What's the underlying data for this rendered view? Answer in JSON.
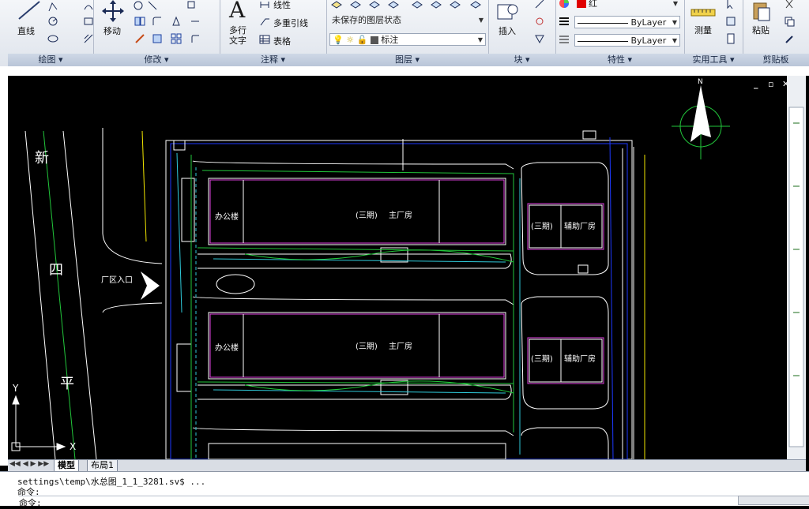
{
  "ribbon": {
    "panels": {
      "draw": {
        "title": "绘图",
        "line_label": "直线"
      },
      "modify": {
        "title": "修改",
        "move_label": "移动"
      },
      "annotation": {
        "title": "注释",
        "mtext_label_1": "多行",
        "mtext_label_2": "文字",
        "linear_label": "线性",
        "mleader_label": "多重引线",
        "table_label": "表格"
      },
      "layers": {
        "title": "图层",
        "layer_state": "未保存的图层状态",
        "current_layer": "标注"
      },
      "block": {
        "title": "块",
        "insert_label": "插入"
      },
      "properties": {
        "title": "特性",
        "color": "红",
        "linetype": "ByLayer",
        "lineweight": "ByLayer"
      },
      "utilities": {
        "title": "实用工具",
        "measure_label": "测量"
      },
      "clipboard": {
        "title": "剪贴板",
        "paste_label": "粘贴"
      }
    }
  },
  "drawing": {
    "road_labels": [
      "新",
      "四",
      "平"
    ],
    "entrance_label": "厂区入口",
    "building_labels": {
      "office1": "办公楼",
      "main1_phase": "(三期)",
      "main1_name": "主厂房",
      "aux1_phase": "(三期)",
      "aux1_name": "辅助厂房",
      "office2": "办公楼",
      "main2_phase": "(三期)",
      "main2_name": "主厂房",
      "aux2_phase": "(三期)",
      "aux2_name": "辅助厂房"
    },
    "compass_label": "N",
    "ucs": {
      "x_label": "X",
      "y_label": "Y"
    }
  },
  "tabs": [
    {
      "label": "模型",
      "active": true
    },
    {
      "label": "布局1",
      "active": false
    }
  ],
  "command": {
    "history_line": "settings\\temp\\水总图_1_1_3281.sv$ ...",
    "prompt_line": "命令:",
    "input_line": "命令:"
  },
  "window_controls": {
    "minimize": "_",
    "restore": "▫",
    "close": "✕"
  },
  "colors": {
    "red": "#e00000",
    "yellow": "#f2e600",
    "green": "#22c63b",
    "cyan": "#2fc9d8",
    "magenta": "#e040e0",
    "white": "#ffffff",
    "blue": "#1d39ff"
  }
}
